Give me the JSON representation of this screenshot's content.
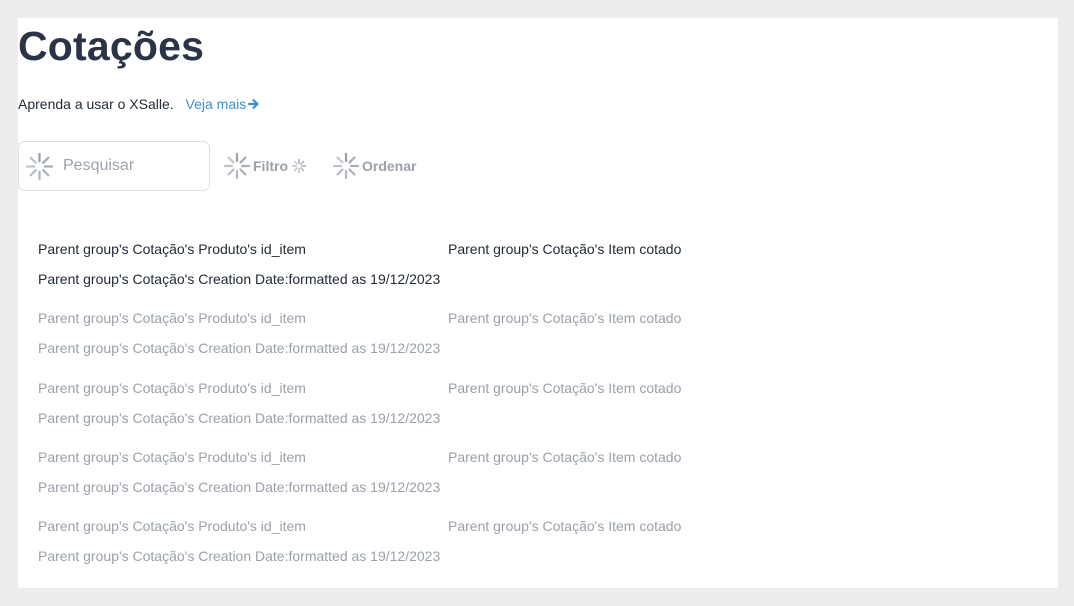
{
  "page": {
    "title": "Cotações",
    "help_text": "Aprenda a usar o XSalle.",
    "help_link": "Veja mais"
  },
  "toolbar": {
    "search_placeholder": "Pesquisar",
    "search_value": "",
    "filter_label": "Filtro",
    "order_label": "Ordenar",
    "icons": {
      "search": "spinner-icon",
      "filter": "spinner-icon",
      "order": "spinner-icon",
      "help_link": "arrow-right-icon"
    }
  },
  "items": [
    {
      "id_item": "Parent group's Cotação's Produto's id_item",
      "item_cotado": "Parent group's Cotação's Item cotado",
      "creation_date": "Parent group's Cotação's Creation Date:formatted as 19/12/2023"
    },
    {
      "id_item": "Parent group's Cotação's Produto's id_item",
      "item_cotado": "Parent group's Cotação's Item cotado",
      "creation_date": "Parent group's Cotação's Creation Date:formatted as 19/12/2023"
    },
    {
      "id_item": "Parent group's Cotação's Produto's id_item",
      "item_cotado": "Parent group's Cotação's Item cotado",
      "creation_date": "Parent group's Cotação's Creation Date:formatted as 19/12/2023"
    },
    {
      "id_item": "Parent group's Cotação's Produto's id_item",
      "item_cotado": "Parent group's Cotação's Item cotado",
      "creation_date": "Parent group's Cotação's Creation Date:formatted as 19/12/2023"
    },
    {
      "id_item": "Parent group's Cotação's Produto's id_item",
      "item_cotado": "Parent group's Cotação's Item cotado",
      "creation_date": "Parent group's Cotação's Creation Date:formatted as 19/12/2023"
    }
  ],
  "colors": {
    "title": "#2a3446",
    "link": "#3b8fd0",
    "muted": "#9aa1ab",
    "text": "#1f2937",
    "page_bg": "#ededed"
  }
}
